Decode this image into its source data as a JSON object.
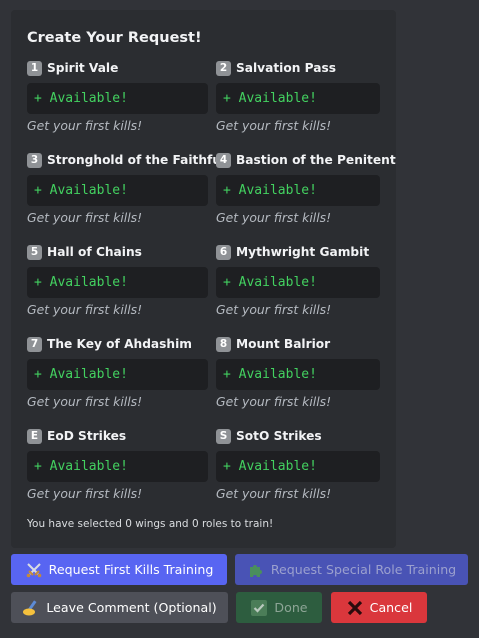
{
  "embed": {
    "title": "Create Your Request!",
    "fields": [
      {
        "key": "1",
        "name": "Spirit Vale",
        "status": "+ Available!",
        "note": "Get your first kills!"
      },
      {
        "key": "2",
        "name": "Salvation Pass",
        "status": "+ Available!",
        "note": "Get your first kills!"
      },
      {
        "key": "3",
        "name": "Stronghold of the Faithful",
        "status": "+ Available!",
        "note": "Get your first kills!"
      },
      {
        "key": "4",
        "name": "Bastion of the Penitent",
        "status": "+ Available!",
        "note": "Get your first kills!"
      },
      {
        "key": "5",
        "name": "Hall of Chains",
        "status": "+ Available!",
        "note": "Get your first kills!"
      },
      {
        "key": "6",
        "name": "Mythwright Gambit",
        "status": "+ Available!",
        "note": "Get your first kills!"
      },
      {
        "key": "7",
        "name": "The Key of Ahdashim",
        "status": "+ Available!",
        "note": "Get your first kills!"
      },
      {
        "key": "8",
        "name": "Mount Balrior",
        "status": "+ Available!",
        "note": "Get your first kills!"
      },
      {
        "key": "E",
        "name": "EoD Strikes",
        "status": "+ Available!",
        "note": "Get your first kills!"
      },
      {
        "key": "S",
        "name": "SotO Strikes",
        "status": "+ Available!",
        "note": "Get your first kills!"
      }
    ],
    "footer": "You have selected 0 wings and 0 roles to train!"
  },
  "buttons": {
    "first_kills": {
      "label": "Request First Kills Training",
      "icon": "crossed-swords-icon"
    },
    "special_role": {
      "label": "Request Special Role Training",
      "icon": "puzzle-piece-icon"
    },
    "comment": {
      "label": "Leave Comment (Optional)",
      "icon": "writing-hand-icon"
    },
    "done": {
      "label": "Done",
      "icon": "check-mark-icon"
    },
    "cancel": {
      "label": "Cancel",
      "icon": "cross-mark-icon"
    }
  },
  "colors": {
    "background": "#313338",
    "embed": "#2b2d31",
    "code_text": "#43d160",
    "primary": "#5865f2",
    "secondary": "#4e5058",
    "success": "#2d5d3f",
    "danger": "#da373c"
  }
}
